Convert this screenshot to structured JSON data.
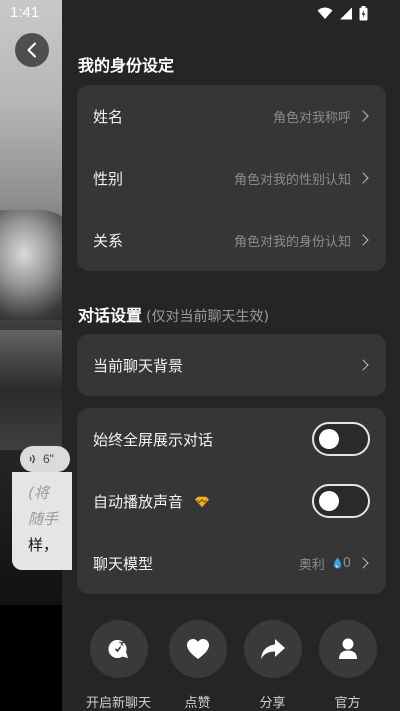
{
  "status_bar": {
    "time": "1:41"
  },
  "background_chat": {
    "audio_duration": "6\"",
    "bubble_lines": [
      "(将",
      "随手",
      "样，"
    ]
  },
  "identity_section": {
    "title": "我的身份设定",
    "rows": [
      {
        "label": "姓名",
        "value": "角色对我称呼"
      },
      {
        "label": "性别",
        "value": "角色对我的性别认知"
      },
      {
        "label": "关系",
        "value": "角色对我的身份认知"
      }
    ]
  },
  "chat_settings": {
    "title": "对话设置",
    "subtitle": "(仅对当前聊天生效)",
    "background_row": {
      "label": "当前聊天背景"
    },
    "fullscreen_row": {
      "label": "始终全屏展示对话",
      "enabled": false
    },
    "autoplay_row": {
      "label": "自动播放声音",
      "enabled": false,
      "badge_icon": "vip-gem-icon"
    },
    "model_row": {
      "label": "聊天模型",
      "value": "奥利",
      "count": "0",
      "drop_icon": "water-drop-icon"
    }
  },
  "actions": [
    {
      "label": "开启新聊天",
      "icon": "new-chat-icon"
    },
    {
      "label": "点赞",
      "icon": "heart-icon"
    },
    {
      "label": "分享",
      "icon": "share-icon"
    },
    {
      "label": "官方",
      "icon": "profile-icon"
    }
  ],
  "colors": {
    "panel_bg": "#252525",
    "card_bg": "#363636",
    "action_bg": "#3a3a3a",
    "badge_gold": "#f2b01e"
  }
}
